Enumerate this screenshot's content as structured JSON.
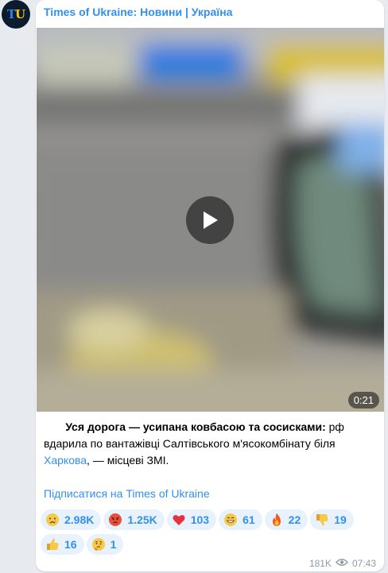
{
  "channel": {
    "avatar_text_t": "T",
    "avatar_text_u": "U",
    "name": "Times of Ukraine: Новини | Україна"
  },
  "video": {
    "duration": "0:21"
  },
  "message": {
    "lead_bold": "Уся дорога — усипана ковбасою та сосисками:",
    "text_before_link": " рф вдарила по вантажівці Салтівського м'ясокомбінату біля ",
    "link": "Харкова",
    "text_after_link": ", — місцеві ЗМІ."
  },
  "subscribe_link": "Підписатися на Times of Ukraine",
  "reactions": [
    {
      "emoji": "crying-face",
      "count": "2.98K"
    },
    {
      "emoji": "angry-face",
      "count": "1.25K"
    },
    {
      "emoji": "red-heart",
      "count": "103"
    },
    {
      "emoji": "grinning-face",
      "count": "61"
    },
    {
      "emoji": "fire",
      "count": "22"
    },
    {
      "emoji": "thumbs-down",
      "count": "19"
    },
    {
      "emoji": "thumbs-up",
      "count": "16"
    },
    {
      "emoji": "thinking-face",
      "count": "1"
    }
  ],
  "footer": {
    "views": "181K",
    "time": "07:43"
  },
  "colors": {
    "accent": "#3390ec",
    "reaction_bg": "#e8f2fc",
    "chat_bg": "#e7ebf0"
  }
}
